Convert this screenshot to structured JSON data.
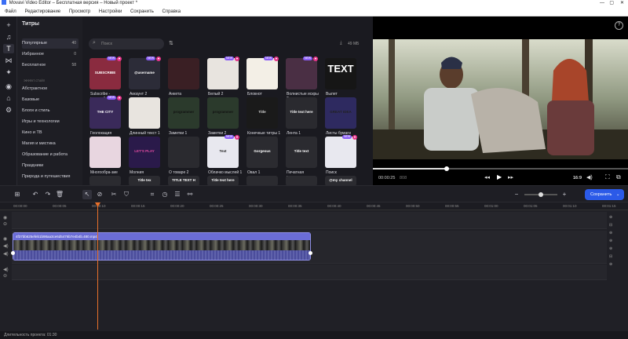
{
  "window": {
    "title": "Movavi Video Editor – Бесплатная версия – Новый проект *"
  },
  "menu": [
    "Файл",
    "Редактирование",
    "Просмотр",
    "Настройки",
    "Сохранить",
    "Справка"
  ],
  "panel": {
    "heading": "Титры",
    "search_placeholder": "Поиск",
    "storage": "49 МБ",
    "categories_top": [
      {
        "label": "Популярные",
        "count": "40"
      },
      {
        "label": "Избранное",
        "count": "0"
      },
      {
        "label": "Бесплатное",
        "count": "58"
      }
    ],
    "effects_heading": "ЭФФЕКТ-СТАЙЛ",
    "categories": [
      "Абстрактное",
      "Базовые",
      "Блоги и стиль",
      "Игры и технологии",
      "Кино и ТВ",
      "Магия и мистика",
      "Образование и работа",
      "Праздники",
      "Природа и путешествия"
    ]
  },
  "tiles": [
    {
      "label": "Subscribe - красный",
      "badge": "NEW",
      "text": "SUBSCRIBE"
    },
    {
      "label": "Аккаунт 2",
      "badge": "NEW",
      "text": "@username"
    },
    {
      "label": "Анкета",
      "badge": "",
      "text": ""
    },
    {
      "label": "Белый 2",
      "badge": "NEW",
      "text": ""
    },
    {
      "label": "Блокнот",
      "badge": "NEW",
      "text": ""
    },
    {
      "label": "Волнистые искры 2",
      "badge": "NEW",
      "text": ""
    },
    {
      "label": "Вылет",
      "badge": "",
      "text": "TEXT"
    },
    {
      "label": "Геолокация",
      "badge": "NEW",
      "text": "THE CITY"
    },
    {
      "label": "Длинный текст 1",
      "badge": "",
      "text": ""
    },
    {
      "label": "Заметки 1",
      "badge": "",
      "text": "programmer"
    },
    {
      "label": "Заметки 2",
      "badge": "",
      "text": "programmer"
    },
    {
      "label": "Конечные титры 1",
      "badge": "",
      "text": "Title"
    },
    {
      "label": "Лента 1",
      "badge": "",
      "text": "Title text here"
    },
    {
      "label": "Листы бумаги",
      "badge": "",
      "text": "GREAT IDEA"
    },
    {
      "label": "Многообра-зие",
      "badge": "",
      "text": ""
    },
    {
      "label": "Молния",
      "badge": "",
      "text": "LET'S PLAY"
    },
    {
      "label": "О товаре 2",
      "badge": "",
      "text": ""
    },
    {
      "label": "Облачко мыслей 1 ✓",
      "badge": "NEW",
      "text": "Text"
    },
    {
      "label": "Овал 1",
      "badge": "",
      "text": "Gorgeous"
    },
    {
      "label": "Печатная машинка",
      "badge": "",
      "text": "Title text"
    },
    {
      "label": "Поиск",
      "badge": "NEW",
      "text": ""
    },
    {
      "label": "",
      "badge": "",
      "text": ""
    },
    {
      "label": "",
      "badge": "",
      "text": "Title tex"
    },
    {
      "label": "",
      "badge": "",
      "text": "TITLE TEXT H"
    },
    {
      "label": "",
      "badge": "",
      "text": "Title text here"
    },
    {
      "label": "",
      "badge": "",
      "text": ""
    },
    {
      "label": "",
      "badge": "",
      "text": ""
    },
    {
      "label": "",
      "badge": "",
      "text": "@my channel"
    }
  ],
  "player": {
    "time_current": "00:00:25",
    "time_frac": "808",
    "aspect": "16:9",
    "progress": 0.29
  },
  "toolbar": {
    "save_label": "Сохранить"
  },
  "timeline": {
    "ticks": [
      "00:00:00",
      "00:00:05",
      "00:00:10",
      "00:00:15",
      "00:00:20",
      "00:00:25",
      "00:00:30",
      "00:00:35",
      "00:00:40",
      "00:00:45",
      "00:00:50",
      "00:00:55",
      "00:01:00",
      "00:01:05",
      "00:01:10",
      "00:01:15"
    ],
    "clip_name": "4f37bb625efeb1b98aa3ce6d5476b7e4b4b.480.mp4"
  },
  "status": {
    "duration": "Длительность проекта: 01:30"
  }
}
